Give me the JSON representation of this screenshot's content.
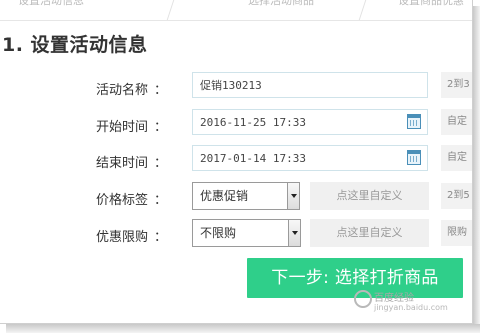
{
  "tabs": [
    {
      "label": "设置活动信息"
    },
    {
      "label": "选择活动商品"
    },
    {
      "label": "设置商品优惠"
    }
  ],
  "section_title": "1. 设置活动信息",
  "form": {
    "name": {
      "label": "活动名称",
      "colon": "：",
      "value": "促销130213",
      "hint": "2到3"
    },
    "start": {
      "label": "开始时间",
      "colon": "：",
      "value": "2016-11-25 17:33",
      "hint": "自定"
    },
    "end": {
      "label": "结束时间",
      "colon": "：",
      "value": "2017-01-14 17:33",
      "hint": "自定"
    },
    "price_tag": {
      "label": "价格标签",
      "colon": "：",
      "selected": "优惠促销",
      "custom": "点这里自定义",
      "hint": "2到5"
    },
    "limit": {
      "label": "优惠限购",
      "colon": "：",
      "selected": "不限购",
      "custom": "点这里自定义",
      "hint": "限购"
    }
  },
  "next_button": "下一步: 选择打折商品",
  "watermark": {
    "text": "百度经验",
    "subtext": "jingyan.baidu.com"
  }
}
